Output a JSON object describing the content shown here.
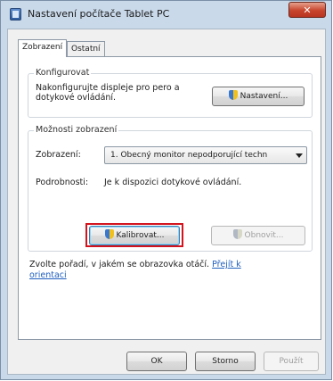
{
  "window": {
    "title": "Nastavení počítače Tablet PC",
    "close_label": "✕"
  },
  "tabs": [
    {
      "label": "Zobrazení",
      "active": true
    },
    {
      "label": "Ostatní",
      "active": false
    }
  ],
  "configure": {
    "group_title": "Konfigurovat",
    "description_line1": "Nakonfigurujte displeje pro pero a",
    "description_line2": "dotykové ovládání.",
    "button_label": "Nastavení..."
  },
  "display_options": {
    "group_title": "Možnosti zobrazení",
    "display_label": "Zobrazení:",
    "display_value": "1. Obecný monitor nepodporující techn",
    "details_label": "Podrobnosti:",
    "details_value": "Je k dispozici dotykové ovládání.",
    "calibrate_label": "Kalibrovat...",
    "reset_label": "Obnovit..."
  },
  "orientation": {
    "text": "Zvolte pořadí, v jakém se obrazovka otáčí.",
    "link_line1": "Přejít k",
    "link_line2": "orientaci"
  },
  "footer": {
    "ok_label": "OK",
    "cancel_label": "Storno",
    "apply_label": "Použít"
  },
  "colors": {
    "highlight": "#d3141e",
    "link": "#1f5fbf"
  }
}
